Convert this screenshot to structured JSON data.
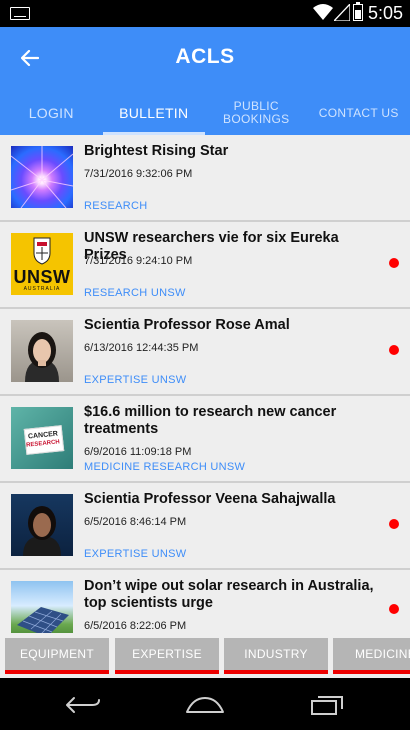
{
  "status_bar": {
    "time": "5:05"
  },
  "app_bar": {
    "title": "ACLS"
  },
  "tabs": [
    {
      "label": "LOGIN",
      "active": false
    },
    {
      "label": "BULLETIN",
      "active": true
    },
    {
      "label": "PUBLIC BOOKINGS",
      "active": false
    },
    {
      "label": "CONTACT US",
      "active": false
    }
  ],
  "bulletins": [
    {
      "title": "Brightest Rising Star",
      "date": "7/31/2016 9:32:06 PM",
      "tags": "RESEARCH",
      "thumbnail": "star-burst",
      "unread": false
    },
    {
      "title": "UNSW researchers vie for six Eureka Prizes",
      "date": "7/31/2016 9:24:10 PM",
      "tags": "RESEARCH UNSW",
      "thumbnail": "unsw-logo",
      "thumbnail_text": "UNSW",
      "thumbnail_subtext": "AUSTRALIA",
      "unread": true
    },
    {
      "title": "Scientia Professor Rose Amal",
      "date": "6/13/2016 12:44:35 PM",
      "tags": "EXPERTISE UNSW",
      "thumbnail": "portrait",
      "unread": true
    },
    {
      "title": "$16.6 million to research new cancer treatments",
      "date": "6/9/2016 11:09:18 PM",
      "tags": "MEDICINE RESEARCH UNSW",
      "thumbnail": "cancer-research-card",
      "thumbnail_text": "CANCER",
      "thumbnail_subtext": "RESEARCH",
      "unread": false
    },
    {
      "title": "Scientia Professor Veena Sahajwalla",
      "date": "6/5/2016 8:46:14 PM",
      "tags": "EXPERTISE UNSW",
      "thumbnail": "portrait",
      "unread": true
    },
    {
      "title": "Don’t wipe out solar research in Australia, top scientists urge",
      "date": "6/5/2016 8:22:06 PM",
      "tags": "",
      "thumbnail": "solar-panels",
      "unread": true
    }
  ],
  "categories": [
    "EQUIPMENT",
    "EXPERTISE",
    "INDUSTRY",
    "MEDICINE"
  ],
  "colors": {
    "primary": "#3e8df8",
    "unread_dot": "#ff0000",
    "category_underline": "#ee0000"
  }
}
